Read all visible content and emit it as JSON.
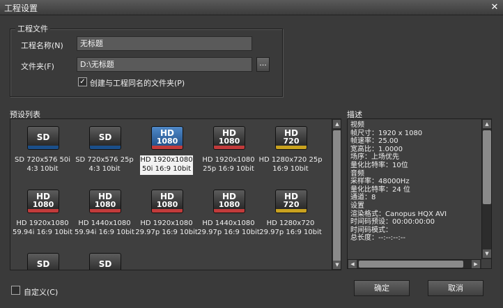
{
  "window": {
    "title": "工程设置",
    "close_glyph": "✕"
  },
  "project_file": {
    "group_title": "工程文件",
    "name_label": "工程名称(N)",
    "name_value": "无标题",
    "folder_label": "文件夹(F)",
    "folder_value": "D:\\无标题",
    "browse_label": "...",
    "create_folder_label": "创建与工程同名的文件夹(P)",
    "create_folder_checked": true
  },
  "presets": {
    "title": "预设列表",
    "items": [
      {
        "badge1": "SD",
        "badge2": "",
        "stripe": "#1b4f8a",
        "line1": "SD 720x576 50i",
        "line2": "4:3 10bit",
        "selected": false
      },
      {
        "badge1": "SD",
        "badge2": "",
        "stripe": "#1b4f8a",
        "line1": "SD 720x576 25p",
        "line2": "4:3 10bit",
        "selected": false
      },
      {
        "badge1": "HD",
        "badge2": "1080",
        "stripe": "#c23b3b",
        "line1": "HD 1920x1080",
        "line2": "50i 16:9 10bit",
        "selected": true
      },
      {
        "badge1": "HD",
        "badge2": "1080",
        "stripe": "#c23b3b",
        "line1": "HD 1920x1080",
        "line2": "25p 16:9 10bit",
        "selected": false
      },
      {
        "badge1": "HD",
        "badge2": "720",
        "stripe": "#c9a21f",
        "line1": "HD 1280x720 25p",
        "line2": "16:9 10bit",
        "selected": false
      },
      {
        "badge1": "HD",
        "badge2": "1080",
        "stripe": "#c23b3b",
        "line1": "HD 1920x1080",
        "line2": "59.94i 16:9 10bit",
        "selected": false
      },
      {
        "badge1": "HD",
        "badge2": "1080",
        "stripe": "#c23b3b",
        "line1": "HD 1440x1080",
        "line2": "59.94i 16:9 10bit",
        "selected": false
      },
      {
        "badge1": "HD",
        "badge2": "1080",
        "stripe": "#c23b3b",
        "line1": "HD 1920x1080",
        "line2": "29.97p 16:9 10bit",
        "selected": false
      },
      {
        "badge1": "HD",
        "badge2": "1080",
        "stripe": "#c23b3b",
        "line1": "HD 1440x1080",
        "line2": "29.97p 16:9 10bit",
        "selected": false
      },
      {
        "badge1": "HD",
        "badge2": "720",
        "stripe": "#c9a21f",
        "line1": "HD 1280x720",
        "line2": "29.97p 16:9 10bit",
        "selected": false
      },
      {
        "badge1": "SD",
        "badge2": "",
        "stripe": "#1b4f8a",
        "line1": "",
        "line2": "",
        "selected": false
      },
      {
        "badge1": "SD",
        "badge2": "",
        "stripe": "#1b4f8a",
        "line1": "",
        "line2": "",
        "selected": false
      }
    ]
  },
  "description": {
    "title": "描述",
    "lines": [
      "视频",
      "  帧尺寸：1920 x 1080",
      "  帧速率：25.00",
      " 宽高比：1.0000",
      "  场序：上场优先",
      " 量化比特率：10位",
      "音频",
      " 采样率：48000Hz",
      " 量化比特率：24 位",
      "  通道：8",
      "设置",
      " 渲染格式：Canopus HQX AVI",
      " 时间码预设：00:00:00:00",
      " 时间码模式：",
      " 总长度：--:--:--:--"
    ]
  },
  "custom": {
    "label": "自定义(C)",
    "checked": false
  },
  "buttons": {
    "ok": "确定",
    "cancel": "取消"
  },
  "scroll": {
    "up": "▲",
    "down": "▼",
    "left": "◀",
    "right": "▶"
  }
}
